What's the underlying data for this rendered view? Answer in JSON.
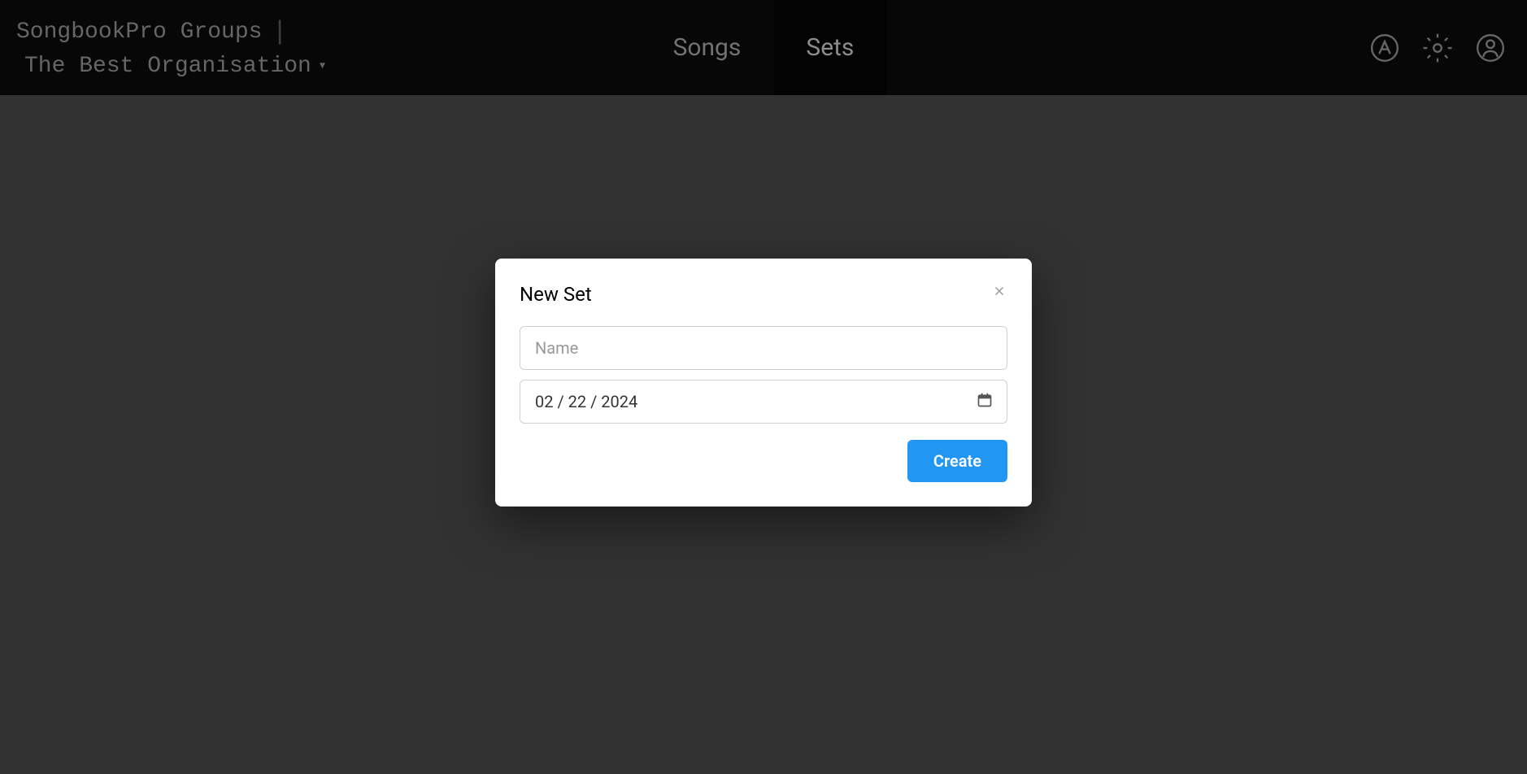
{
  "header": {
    "app_title": "SongbookPro Groups",
    "org_name": "The Best Organisation"
  },
  "tabs": {
    "songs": "Songs",
    "sets": "Sets"
  },
  "modal": {
    "title": "New Set",
    "name_placeholder": "Name",
    "date_value": "02 / 22 / 2024",
    "create_label": "Create"
  }
}
